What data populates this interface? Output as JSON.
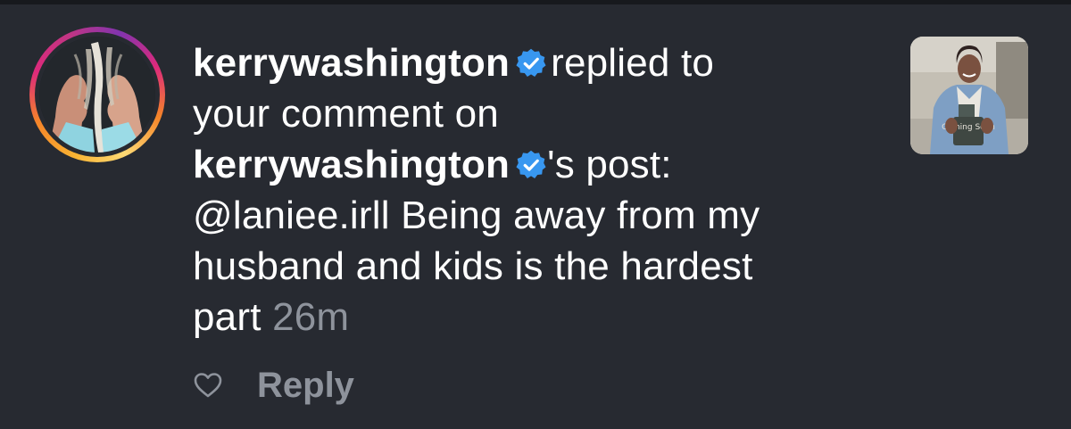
{
  "notification": {
    "actor_username": "kerrywashington",
    "action_text": "replied to",
    "line2_text": "your comment on",
    "post_owner_username": "kerrywashington",
    "post_suffix": "'s post:",
    "reply_line1": "@laniee.irll Being away from my",
    "reply_line2": "husband and kids is the hardest",
    "reply_line3": "part",
    "timestamp": "26m",
    "verified_badge_icon": "verified-badge-icon",
    "post_thumbnail_text": "Coming Soon"
  },
  "actions": {
    "like_icon": "heart-outline-icon",
    "reply_label": "Reply"
  },
  "colors": {
    "background": "#272a31",
    "text_primary": "#ffffff",
    "text_secondary": "#8e939c",
    "verified_blue": "#3897f0"
  }
}
